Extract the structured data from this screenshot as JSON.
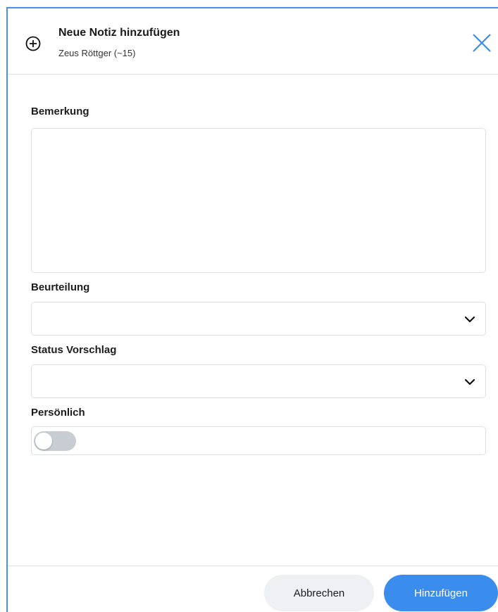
{
  "dialog": {
    "title": "Neue Notiz hinzufügen",
    "subtitle": "Zeus Röttger (~15)",
    "header_icon": "add-circle-icon",
    "close_icon": "close-icon"
  },
  "form": {
    "remark_label": "Bemerkung",
    "remark_value": "",
    "rating_label": "Beurteilung",
    "rating_value": "",
    "status_label": "Status Vorschlag",
    "status_value": "",
    "personal_label": "Persönlich",
    "personal_on": false
  },
  "footer": {
    "cancel_label": "Abbrechen",
    "add_label": "Hinzufügen"
  },
  "colors": {
    "accent": "#3b8ded",
    "border": "#dcdfe4",
    "toggle_off": "#c8cdd3"
  }
}
